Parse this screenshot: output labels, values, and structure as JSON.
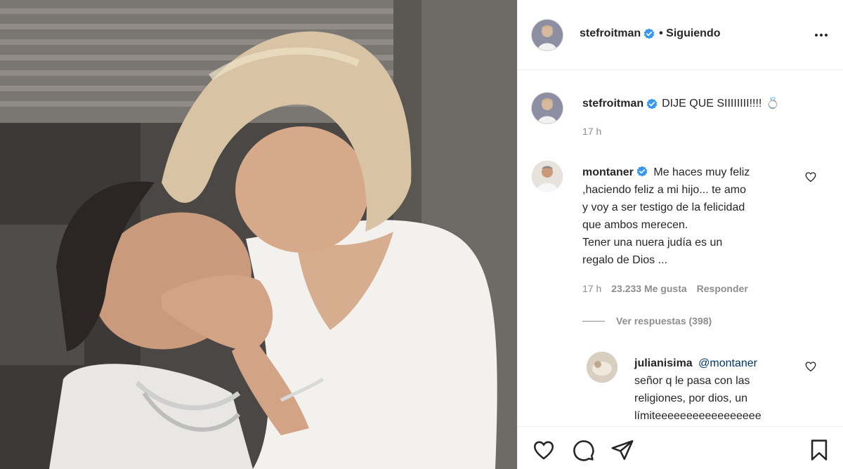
{
  "post": {
    "author": "stefroitman",
    "follow_status": "• Siguiendo",
    "photo_alt": "couple-photo"
  },
  "caption": {
    "username": "stefroitman",
    "text": "DIJE QUE SIIIIIIII!!!!",
    "emoji": "💍",
    "time": "17 h"
  },
  "comments": [
    {
      "username": "montaner",
      "verified": true,
      "lines": [
        "Me haces muy feliz",
        ",haciendo feliz a mi hijo... te amo",
        "y voy a ser testigo de la felicidad",
        "que ambos merecen.",
        "Tener una nuera judía es un",
        "regalo de Dios ..."
      ],
      "time": "17 h",
      "likes": "23.233 Me gusta",
      "reply_label": "Responder",
      "view_replies": "Ver respuestas (398)"
    }
  ],
  "replies": [
    {
      "username": "julianisima",
      "mention": "@montaner",
      "lines": [
        "señor q le pasa con las",
        "religiones, por dios, un",
        "límiteeeeeeeeeeeeeeeee"
      ]
    }
  ],
  "icons": {
    "more": "more-options-icon",
    "heart": "heart-icon",
    "comment": "comment-icon",
    "share": "share-icon",
    "save": "bookmark-icon",
    "verified": "verified-badge-icon"
  },
  "colors": {
    "verified": "#3897f0",
    "mention": "#00376b",
    "muted": "#8e8e8e",
    "text": "#262626"
  }
}
